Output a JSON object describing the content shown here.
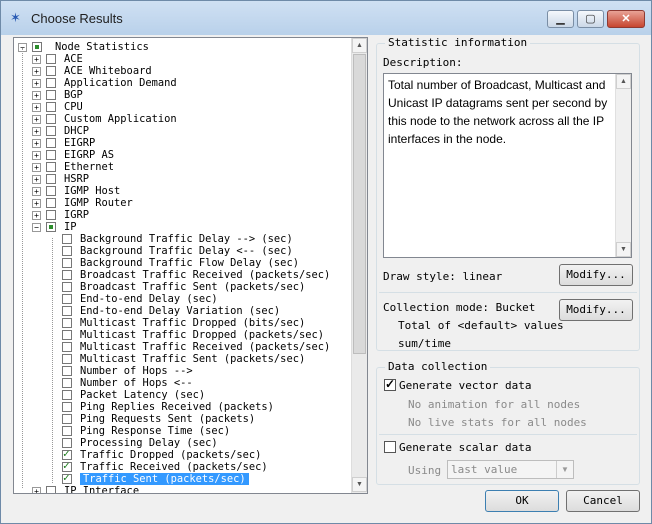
{
  "window": {
    "title": "Choose Results"
  },
  "tree": {
    "root": "Node Statistics",
    "items": [
      {
        "label": "ACE"
      },
      {
        "label": "ACE Whiteboard"
      },
      {
        "label": "Application Demand"
      },
      {
        "label": "BGP"
      },
      {
        "label": "CPU"
      },
      {
        "label": "Custom Application"
      },
      {
        "label": "DHCP"
      },
      {
        "label": "EIGRP"
      },
      {
        "label": "EIGRP AS"
      },
      {
        "label": "Ethernet"
      },
      {
        "label": "HSRP"
      },
      {
        "label": "IGMP Host"
      },
      {
        "label": "IGMP Router"
      },
      {
        "label": "IGRP"
      },
      {
        "label": "IP"
      }
    ],
    "ip_children": [
      {
        "label": "Background Traffic Delay --> (sec)",
        "checked": false
      },
      {
        "label": "Background Traffic Delay <-- (sec)",
        "checked": false
      },
      {
        "label": "Background Traffic Flow Delay (sec)",
        "checked": false
      },
      {
        "label": "Broadcast Traffic Received (packets/sec)",
        "checked": false
      },
      {
        "label": "Broadcast Traffic Sent (packets/sec)",
        "checked": false
      },
      {
        "label": "End-to-end Delay (sec)",
        "checked": false
      },
      {
        "label": "End-to-end Delay Variation (sec)",
        "checked": false
      },
      {
        "label": "Multicast Traffic Dropped (bits/sec)",
        "checked": false
      },
      {
        "label": "Multicast Traffic Dropped (packets/sec)",
        "checked": false
      },
      {
        "label": "Multicast Traffic Received (packets/sec)",
        "checked": false
      },
      {
        "label": "Multicast Traffic Sent (packets/sec)",
        "checked": false
      },
      {
        "label": "Number of Hops -->",
        "checked": false
      },
      {
        "label": "Number of Hops <--",
        "checked": false
      },
      {
        "label": "Packet Latency (sec)",
        "checked": false
      },
      {
        "label": "Ping Replies Received (packets)",
        "checked": false
      },
      {
        "label": "Ping Requests Sent (packets)",
        "checked": false
      },
      {
        "label": "Ping Response Time (sec)",
        "checked": false
      },
      {
        "label": "Processing Delay (sec)",
        "checked": false
      },
      {
        "label": "Traffic Dropped (packets/sec)",
        "checked": true
      },
      {
        "label": "Traffic Received (packets/sec)",
        "checked": true
      },
      {
        "label": "Traffic Sent (packets/sec)",
        "checked": true,
        "selected": true
      }
    ],
    "after": {
      "label": "IP Interface"
    }
  },
  "stat_info": {
    "title": "Statistic information",
    "description_label": "Description:",
    "description": "Total number of Broadcast, Multicast and Unicast IP datagrams sent per second by this node to the network across all the IP interfaces in the node.",
    "draw_style": "Draw style: linear",
    "modify1": "Modify...",
    "collection_mode": "Collection mode: Bucket",
    "collection_detail1": "Total of <default> values",
    "collection_detail2": "sum/time",
    "modify2": "Modify..."
  },
  "data_collection": {
    "title": "Data collection",
    "vector_label": "Generate vector data",
    "vector_checked": true,
    "no_animation": "No animation for all nodes",
    "no_live": "No live stats for all nodes",
    "scalar_label": "Generate scalar data",
    "scalar_checked": false,
    "using_label": "Using",
    "using_value": "last value"
  },
  "buttons": {
    "ok": "OK",
    "cancel": "Cancel"
  }
}
